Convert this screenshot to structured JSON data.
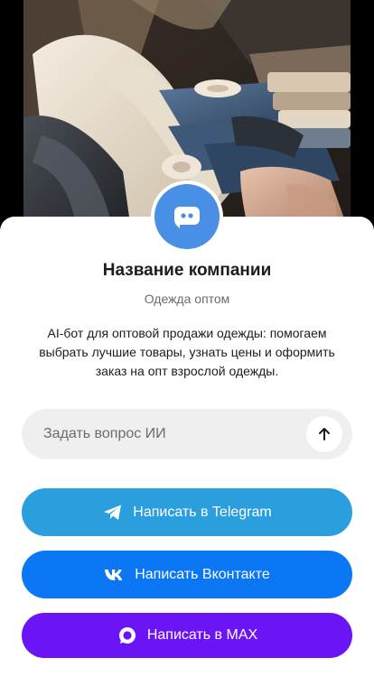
{
  "hero": {
    "image": "clothing-fabrics-photo"
  },
  "company": {
    "avatar_icon": "chat-bubble-icon",
    "name": "Название компании",
    "subtitle": "Одежда оптом",
    "description": "AI-бот для оптовой продажи одежды: помогаем выбрать лучшие товары, узнать цены и оформить заказ на опт взрослой одежды."
  },
  "ask": {
    "placeholder": "Задать вопрос ИИ",
    "value": "",
    "send_icon": "arrow-up-icon"
  },
  "buttons": {
    "telegram": {
      "label": "Написать в Telegram",
      "icon": "telegram-icon",
      "color": "#2b9fde"
    },
    "vk": {
      "label": "Написать Вконтакте",
      "icon": "vk-icon",
      "color": "#0b77f4"
    },
    "max": {
      "label": "Написать в MAX",
      "icon": "max-icon",
      "color": "#6b15f7"
    }
  },
  "colors": {
    "accent": "#4a8fe6",
    "text": "#1c1c1e",
    "muted": "#6b6b70",
    "input_bg": "#efefef"
  }
}
